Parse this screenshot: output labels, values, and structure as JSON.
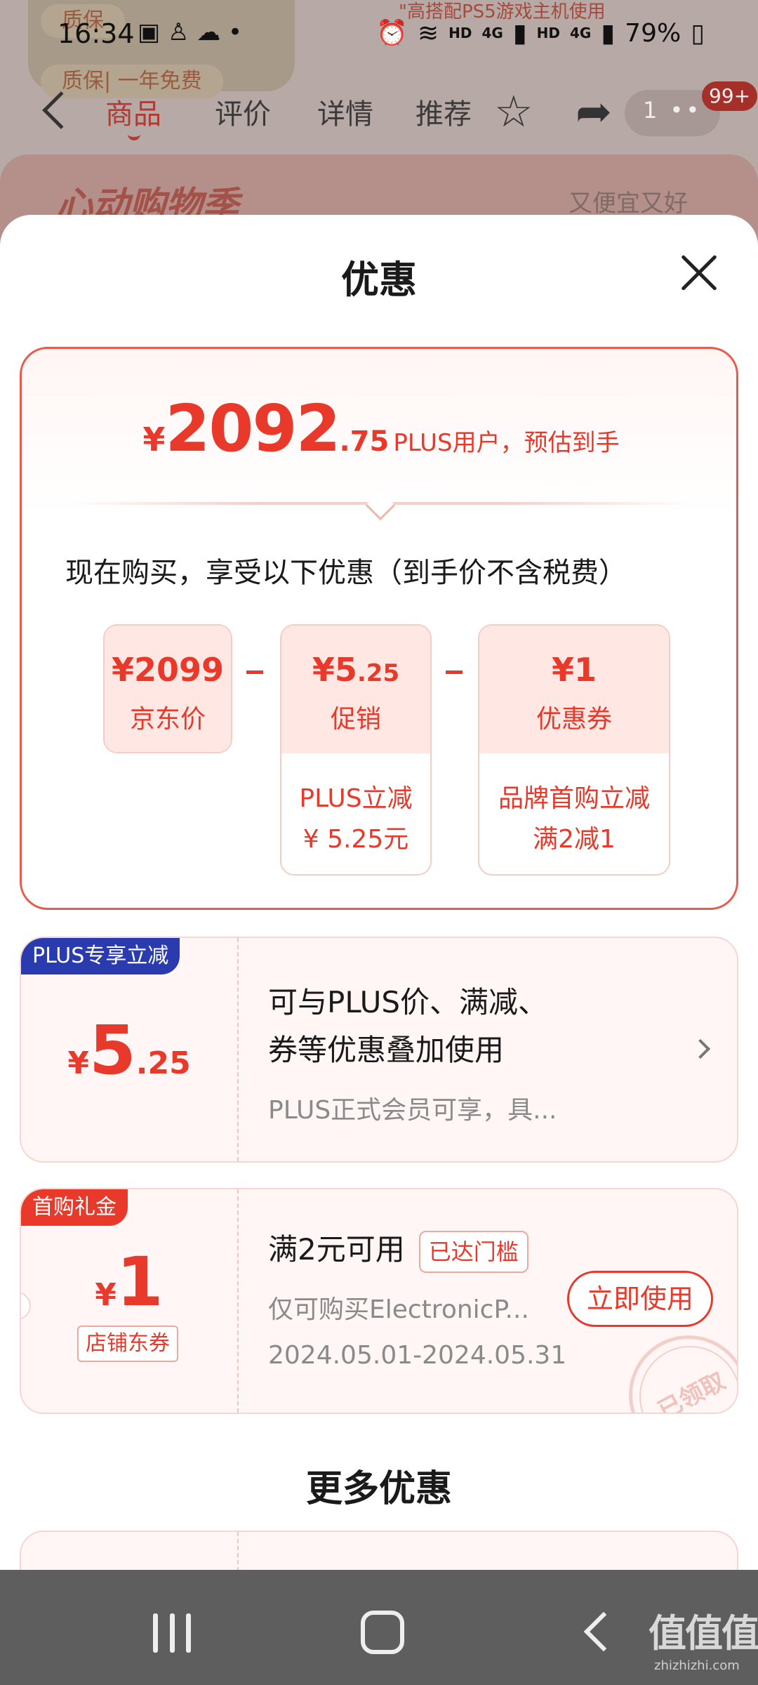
{
  "status_bar": {
    "time": "16:34",
    "left_icons": [
      "image-icon",
      "person-icon",
      "wechat-icon",
      "dot-icon"
    ],
    "battery": "79%",
    "network_1": "HD",
    "network_2": "4G",
    "network_3": "HD",
    "network_4": "4G"
  },
  "background_page": {
    "promo_text": "\"高搭配PS5游戏主机使用",
    "chip_1": "质保",
    "chip_2": "质保| 一年免费",
    "tabs": [
      "商品",
      "评价",
      "详情",
      "推荐"
    ],
    "active_tab": "商品",
    "badge": "99+",
    "more_count": "1",
    "strip_left": "心动购物季",
    "strip_right": "又便宜又好"
  },
  "sheet": {
    "title": "优惠",
    "summary": {
      "currency": "¥",
      "price_int": "2092",
      "price_dec": ".75",
      "price_label": "PLUS用户，预估到手",
      "description": "现在购买，享受以下优惠（到手价不含税费）",
      "items": [
        {
          "value_main": "¥2099",
          "value_dec": "",
          "name": "京东价",
          "detail_1": "",
          "detail_2": ""
        },
        {
          "value_main": "¥5",
          "value_dec": ".25",
          "name": "促销",
          "detail_1": "PLUS立减",
          "detail_2": "¥ 5.25元"
        },
        {
          "value_main": "¥1",
          "value_dec": "",
          "name": "优惠券",
          "detail_1": "品牌首购立减",
          "detail_2": "满2减1"
        }
      ]
    },
    "coupons": [
      {
        "tag": "PLUS专享立减",
        "currency": "¥",
        "amount_int": "5",
        "amount_dec": ".25",
        "line_1": "可与PLUS价、满减、",
        "line_2": "券等优惠叠加使用",
        "sub": "PLUS正式会员可享，具..."
      },
      {
        "tag": "首购礼金",
        "currency": "¥",
        "amount_int": "1",
        "store_label": "店铺东券",
        "condition": "满2元可用",
        "threshold_badge": "已达门槛",
        "scope": "仅可购买ElectronicP...",
        "validity": "2024.05.01-2024.05.31",
        "button": "立即使用",
        "stamp": "已领取"
      }
    ],
    "more_title": "更多优惠"
  },
  "watermark": {
    "logo": "值值值",
    "url": "zhizhizhi.com"
  }
}
